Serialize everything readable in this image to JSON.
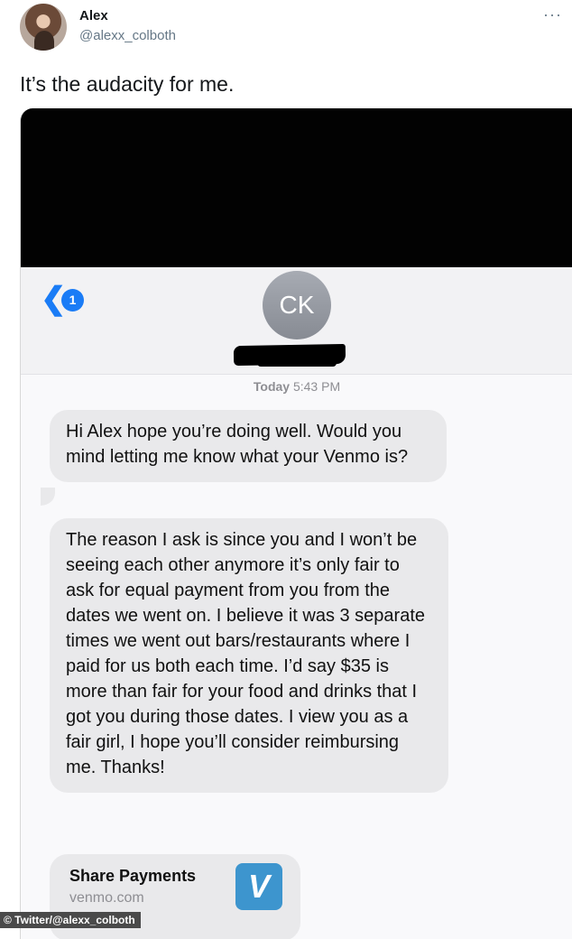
{
  "tweet": {
    "author_name": "Alex",
    "author_handle": "@alexx_colboth",
    "more_glyph": "···",
    "text": "It’s the audacity for me."
  },
  "screenshot": {
    "back_chevron": "❮",
    "back_badge": "1",
    "contact_initials": "CK",
    "timestamp_day": "Today",
    "timestamp_time": "5:43 PM",
    "messages": [
      "Hi Alex hope you’re doing well. Would you mind letting me know what your Venmo is?",
      "The reason I ask is since you and I won’t be seeing each other anymore it’s only fair to ask for equal payment from you from the dates we went on. I believe it was 3 separate times we went out bars/restaurants where I paid for us both each time. I’d say $35 is more than fair for your food and drinks that I got you during those dates. I view you as a fair girl, I hope you’ll consider reimbursing me. Thanks!"
    ],
    "link_preview": {
      "title": "Share Payments",
      "domain": "venmo.com",
      "logo_letter": "V"
    }
  },
  "credit": "© Twitter/@alexx_colboth",
  "colors": {
    "ios_blue": "#1a7cf6",
    "bubble_gray": "#e9e9eb",
    "venmo_blue": "#3d95ce"
  }
}
